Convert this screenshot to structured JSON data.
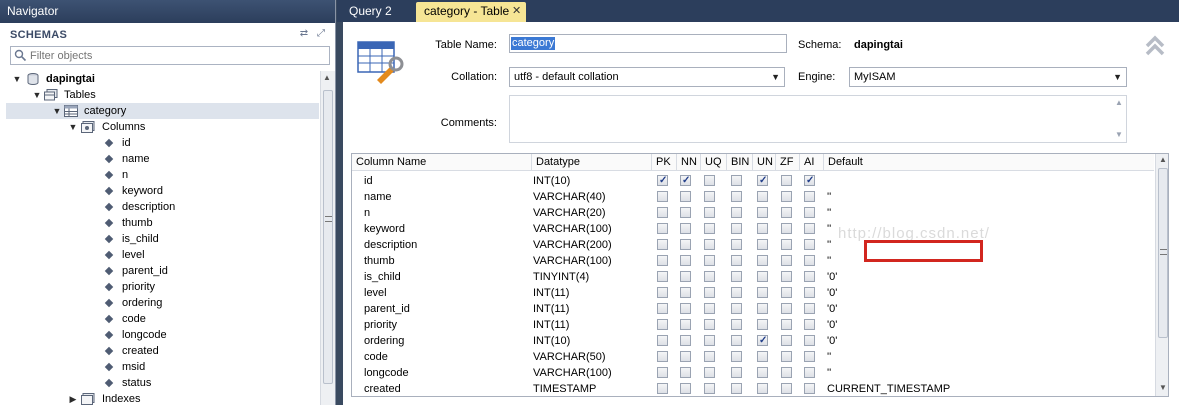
{
  "navigator": {
    "title": "Navigator",
    "schemas_label": "SCHEMAS",
    "filter_placeholder": "Filter objects",
    "tree": {
      "schema": "dapingtai",
      "tables_label": "Tables",
      "table": "category",
      "columns_label": "Columns",
      "columns": [
        "id",
        "name",
        "n",
        "keyword",
        "description",
        "thumb",
        "is_child",
        "level",
        "parent_id",
        "priority",
        "ordering",
        "code",
        "longcode",
        "created",
        "msid",
        "status"
      ],
      "indexes_label": "Indexes"
    }
  },
  "tabs": [
    {
      "label": "Query 2"
    },
    {
      "label": "category - Table"
    }
  ],
  "editor": {
    "table_name_label": "Table Name:",
    "table_name_value": "category",
    "schema_label": "Schema:",
    "schema_value": "dapingtai",
    "collation_label": "Collation:",
    "collation_value": "utf8 - default collation",
    "engine_label": "Engine:",
    "engine_value": "MyISAM",
    "comments_label": "Comments:",
    "grid": {
      "headers": [
        "Column Name",
        "Datatype",
        "PK",
        "NN",
        "UQ",
        "BIN",
        "UN",
        "ZF",
        "AI",
        "Default"
      ],
      "rows": [
        {
          "name": "id",
          "type": "INT(10)",
          "flags": [
            true,
            true,
            false,
            false,
            true,
            false,
            true
          ],
          "default": ""
        },
        {
          "name": "name",
          "type": "VARCHAR(40)",
          "flags": [
            false,
            false,
            false,
            false,
            false,
            false,
            false
          ],
          "default": "''"
        },
        {
          "name": "n",
          "type": "VARCHAR(20)",
          "flags": [
            false,
            false,
            false,
            false,
            false,
            false,
            false
          ],
          "default": "''"
        },
        {
          "name": "keyword",
          "type": "VARCHAR(100)",
          "flags": [
            false,
            false,
            false,
            false,
            false,
            false,
            false
          ],
          "default": "''"
        },
        {
          "name": "description",
          "type": "VARCHAR(200)",
          "flags": [
            false,
            false,
            false,
            false,
            false,
            false,
            false
          ],
          "default": "''"
        },
        {
          "name": "thumb",
          "type": "VARCHAR(100)",
          "flags": [
            false,
            false,
            false,
            false,
            false,
            false,
            false
          ],
          "default": "''"
        },
        {
          "name": "is_child",
          "type": "TINYINT(4)",
          "flags": [
            false,
            false,
            false,
            false,
            false,
            false,
            false
          ],
          "default": "'0'"
        },
        {
          "name": "level",
          "type": "INT(11)",
          "flags": [
            false,
            false,
            false,
            false,
            false,
            false,
            false
          ],
          "default": "'0'"
        },
        {
          "name": "parent_id",
          "type": "INT(11)",
          "flags": [
            false,
            false,
            false,
            false,
            false,
            false,
            false
          ],
          "default": "'0'"
        },
        {
          "name": "priority",
          "type": "INT(11)",
          "flags": [
            false,
            false,
            false,
            false,
            false,
            false,
            false
          ],
          "default": "'0'"
        },
        {
          "name": "ordering",
          "type": "INT(10)",
          "flags": [
            false,
            false,
            false,
            false,
            true,
            false,
            false
          ],
          "default": "'0'"
        },
        {
          "name": "code",
          "type": "VARCHAR(50)",
          "flags": [
            false,
            false,
            false,
            false,
            false,
            false,
            false
          ],
          "default": "''"
        },
        {
          "name": "longcode",
          "type": "VARCHAR(100)",
          "flags": [
            false,
            false,
            false,
            false,
            false,
            false,
            false
          ],
          "default": "''"
        },
        {
          "name": "created",
          "type": "TIMESTAMP",
          "flags": [
            false,
            false,
            false,
            false,
            false,
            false,
            false
          ],
          "default": "CURRENT_TIMESTAMP"
        }
      ]
    },
    "watermark": "http://blog.csdn.net/"
  },
  "colors": {
    "titlebar": "#2c3e5c",
    "active_tab": "#f6e595",
    "highlight_box": "#d2261f",
    "selection": "#3b79d4"
  }
}
